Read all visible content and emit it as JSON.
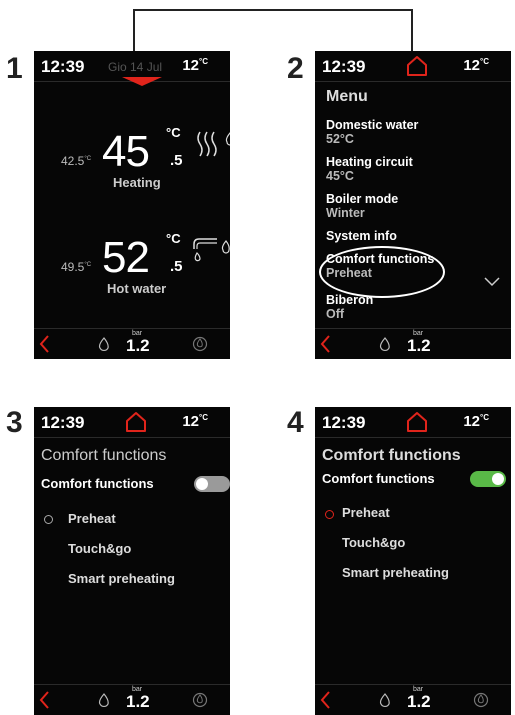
{
  "steps": [
    "1",
    "2",
    "3",
    "4"
  ],
  "common": {
    "time": "12:39",
    "outdoor_temp": "12",
    "outdoor_unit": "°C",
    "pressure_unit": "bar",
    "pressure_value": "1.2"
  },
  "screen1": {
    "date": "Gio 14 Jul",
    "heating": {
      "setpoint": "42.5",
      "setpoint_unit": "°C",
      "value_int": "45",
      "value_dec": ".5",
      "unit": "°C",
      "label": "Heating"
    },
    "hot_water": {
      "setpoint": "49.5",
      "setpoint_unit": "°C",
      "value_int": "52",
      "value_dec": ".5",
      "unit": "°C",
      "label": "Hot water"
    }
  },
  "screen2": {
    "title": "Menu",
    "items": [
      {
        "label": "Domestic water",
        "value": "52°C"
      },
      {
        "label": "Heating circuit",
        "value": "45°C"
      },
      {
        "label": "Boiler mode",
        "value": "Winter"
      },
      {
        "label": "System info",
        "value": ""
      },
      {
        "label": "Comfort functions",
        "value": "Preheat"
      },
      {
        "label": "Biberon",
        "value": "Off"
      }
    ]
  },
  "screen3": {
    "title": "Comfort functions",
    "toggle_label": "Comfort functions",
    "toggle_on": false,
    "options": [
      "Preheat",
      "Touch&go",
      "Smart preheating"
    ]
  },
  "screen4": {
    "title": "Comfort functions",
    "toggle_label": "Comfort functions",
    "toggle_on": true,
    "options": [
      "Preheat",
      "Touch&go",
      "Smart preheating"
    ]
  },
  "colors": {
    "accent_red": "#e0241b",
    "toggle_on": "#59b947",
    "toggle_off": "#9a9a9a",
    "screen_bg": "#060606"
  }
}
